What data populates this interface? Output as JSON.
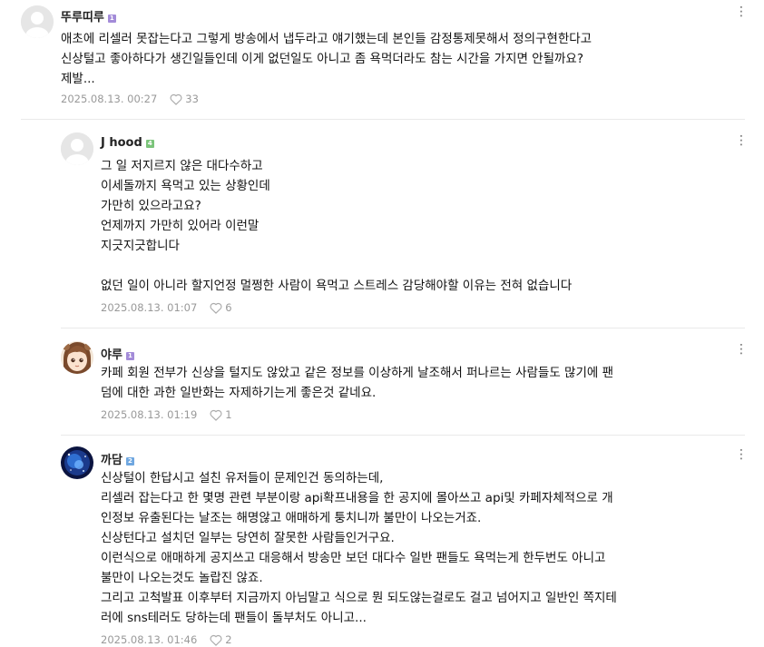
{
  "comments": [
    {
      "author": "뚜루띠루",
      "badge": "1",
      "lines": [
        "애초에 리셀러 못잡는다고 그렇게 방송에서 냅두라고 얘기했는데 본인들 감정통제못해서 정의구현한다고",
        "신상털고 좋아하다가 생긴일들인데 이게 없던일도 아니고 좀 욕먹더라도 참는 시간을 가지면 안될까요?",
        "제발..."
      ],
      "date": "2025.08.13. 00:27",
      "likes": "33"
    },
    {
      "author": "J hood",
      "badge": "4",
      "lines": [
        "그 일 저지르지 않은 대다수하고",
        "이세돌까지 욕먹고 있는 상황인데",
        "가만히 있으라고요?",
        "언제까지 가만히 있어라 이런말",
        "지긋지긋합니다",
        "",
        "없던 일이 아니라 할지언정 멀쩡한 사람이 욕먹고 스트레스 감당해야할 이유는 전혀 없습니다"
      ],
      "date": "2025.08.13. 01:07",
      "likes": "6"
    },
    {
      "author": "야루",
      "badge": "1",
      "lines": [
        "카페 회원 전부가 신상을 털지도 않았고 같은 정보를 이상하게 날조해서 퍼나르는 사람들도 많기에 팬",
        "덤에 대한 과한 일반화는 자제하기는게 좋은것 같네요."
      ],
      "date": "2025.08.13. 01:19",
      "likes": "1"
    },
    {
      "author": "까담",
      "badge": "2",
      "lines": [
        "신상털이 한답시고 설친 유저들이 문제인건 동의하는데,",
        "리셀러 잡는다고 한 몇명 관련 부분이랑 api확프내용을 한 공지에 몰아쓰고 api및 카페자체적으로 개",
        "인정보 유출된다는 날조는 해명않고 애매하게 퉁치니까 불만이 나오는거죠.",
        "신상턴다고 설치던 일부는 당연히 잘못한 사람들인거구요.",
        "이런식으로 애매하게 공지쓰고 대응해서 방송만 보던 대다수 일반 팬들도 욕먹는게 한두번도 아니고",
        "불만이 나오는것도 놀랍진 않죠.",
        "그리고 고척발표 이후부터 지금까지 아님말고 식으로 뭔 되도않는걸로도 걸고 넘어지고 일반인 쪽지테",
        "러에 sns테러도 당하는데 팬들이 돌부처도 아니고..."
      ],
      "date": "2025.08.13. 01:46",
      "likes": "2"
    }
  ],
  "icons": {
    "more": "more-vertical-icon",
    "like": "heart-icon"
  },
  "colors": {
    "badge_purple": "#a38bd8",
    "badge_green": "#7bc47a",
    "badge_blue": "#6fa7e0",
    "meta": "#999999"
  }
}
